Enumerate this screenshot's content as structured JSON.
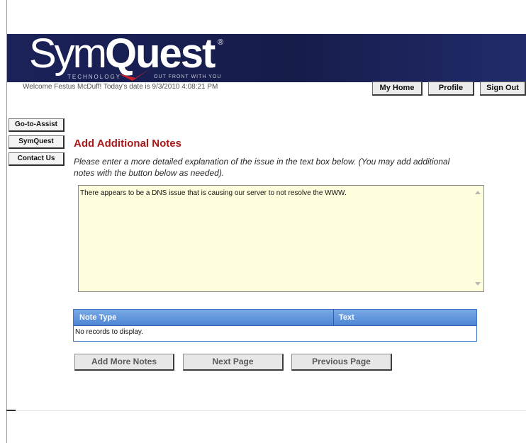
{
  "brand": {
    "logo_light": "Sym",
    "logo_bold": "Quest",
    "registered": "®",
    "tagline_left": "TECHNOLOGY",
    "tagline_right": "OUT FRONT WITH YOU"
  },
  "header": {
    "welcome": "Welcome Festus McDuff! Today's date is 9/3/2010 4:08:21 PM",
    "buttons": [
      "My Home",
      "Profile",
      "Sign Out"
    ]
  },
  "sidebar": {
    "items": [
      "Go-to-Assist",
      "SymQuest",
      "Contact Us"
    ]
  },
  "main": {
    "title": "Add Additional Notes",
    "instructions": "Please enter a more detailed explanation of the issue in the text box below. (You may add additional notes with the button below as needed).",
    "notes_value": "There appears to be a DNS issue that is causing our server to not resolve the WWW.",
    "grid": {
      "columns": [
        "Note Type",
        "Text"
      ],
      "empty_message": "No records to display."
    },
    "actions": [
      "Add More Notes",
      "Next Page",
      "Previous Page"
    ]
  },
  "colors": {
    "banner": "#1b2259",
    "title": "#a61a1a",
    "notes_bg": "#ffffdd",
    "grid_header": "#4e86d4"
  }
}
